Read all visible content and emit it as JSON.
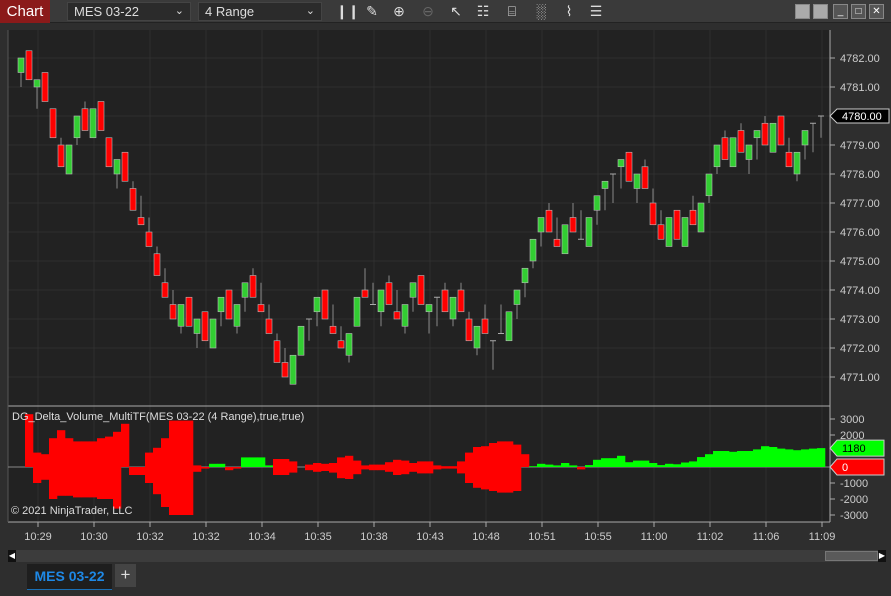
{
  "toolbar": {
    "chart_label": "Chart",
    "instrument": "MES 03-22",
    "bar_type": "4 Range",
    "icons": [
      "bar-type-icon",
      "drawing-tool-icon",
      "zoom-in-icon",
      "zoom-out-icon",
      "pointer-icon",
      "data-box-icon",
      "chart-trader-icon",
      "indicators-icon",
      "strategies-icon",
      "properties-icon"
    ],
    "window_buttons": [
      "minimize",
      "maximize",
      "close"
    ]
  },
  "colors": {
    "up": "#32cd32",
    "down": "#ff0000",
    "background": "#222222",
    "grid": "#2f2f2f",
    "delta_up": "#00ff00",
    "delta_down": "#ff0000"
  },
  "price_axis": {
    "labels": [
      "4782.00",
      "4781.00",
      "4780.00",
      "4779.00",
      "4778.00",
      "4777.00",
      "4776.00",
      "4775.00",
      "4774.00",
      "4773.00",
      "4772.00",
      "4771.00"
    ],
    "current": "4780.00"
  },
  "indicator": {
    "title": "DG_Delta_Volume_MultiTF(MES 03-22 (4 Range),true,true)",
    "labels": [
      "3000",
      "2000",
      "-1000",
      "-2000",
      "-3000"
    ],
    "current_up": "1180",
    "current_down": "0"
  },
  "copyright": "© 2021 NinjaTrader, LLC",
  "time_axis": {
    "labels": [
      "10:29",
      "10:30",
      "10:32",
      "10:32",
      "10:34",
      "10:35",
      "10:38",
      "10:43",
      "10:48",
      "10:51",
      "10:55",
      "11:00",
      "11:02",
      "11:06",
      "11:09"
    ]
  },
  "tabs": [
    {
      "label": "MES 03-22",
      "active": true
    }
  ],
  "chart_data": {
    "type": "candlestick",
    "ohlc_order": "open,high,low,close",
    "candles": [
      [
        4781.5,
        4782,
        4781,
        4782
      ],
      [
        4782.25,
        4782.25,
        4781.25,
        4781.25
      ],
      [
        4781,
        4781.25,
        4780.25,
        4781.25
      ],
      [
        4781.5,
        4781.5,
        4780.5,
        4780.5
      ],
      [
        4780.25,
        4780.25,
        4779.25,
        4779.25
      ],
      [
        4779,
        4779.25,
        4778.25,
        4778.25
      ],
      [
        4778,
        4779,
        4778,
        4779
      ],
      [
        4779.25,
        4780,
        4779,
        4780
      ],
      [
        4780.25,
        4780.5,
        4779.5,
        4779.5
      ],
      [
        4779.25,
        4780.25,
        4779.25,
        4780.25
      ],
      [
        4780.5,
        4780.5,
        4779.5,
        4779.5
      ],
      [
        4779.25,
        4779.25,
        4778.25,
        4778.25
      ],
      [
        4778,
        4778.5,
        4777.5,
        4778.5
      ],
      [
        4778.75,
        4778.75,
        4777.75,
        4777.75
      ],
      [
        4777.5,
        4777.75,
        4776.75,
        4776.75
      ],
      [
        4776.5,
        4777.25,
        4776.25,
        4776.25
      ],
      [
        4776,
        4776.5,
        4775.5,
        4775.5
      ],
      [
        4775.25,
        4775.5,
        4774.5,
        4774.5
      ],
      [
        4774.25,
        4774.75,
        4773.75,
        4773.75
      ],
      [
        4773.5,
        4774,
        4773,
        4773
      ],
      [
        4772.75,
        4773.5,
        4772.5,
        4773.5
      ],
      [
        4773.75,
        4773.75,
        4772.75,
        4772.75
      ],
      [
        4772.5,
        4773,
        4772,
        4773
      ],
      [
        4773.25,
        4773.25,
        4772.25,
        4772.25
      ],
      [
        4772,
        4773,
        4772,
        4773
      ],
      [
        4773.25,
        4773.75,
        4772.75,
        4773.75
      ],
      [
        4774,
        4774,
        4773,
        4773
      ],
      [
        4772.75,
        4773.5,
        4772.5,
        4773.5
      ],
      [
        4773.75,
        4774.25,
        4773.25,
        4774.25
      ],
      [
        4774.5,
        4774.75,
        4773.75,
        4773.75
      ],
      [
        4773.5,
        4774.25,
        4773.25,
        4773.25
      ],
      [
        4773,
        4773.5,
        4772.5,
        4772.5
      ],
      [
        4772.25,
        4772.5,
        4771.5,
        4771.5
      ],
      [
        4771.5,
        4772,
        4771,
        4771
      ],
      [
        4770.75,
        4771.75,
        4770.75,
        4771.75
      ],
      [
        4771.75,
        4772.75,
        4771.75,
        4772.75
      ],
      [
        4773,
        4773,
        4772.25,
        4773
      ],
      [
        4773.25,
        4773.75,
        4772.75,
        4773.75
      ],
      [
        4774,
        4774,
        4773,
        4773
      ],
      [
        4772.75,
        4773.5,
        4772.5,
        4772.5
      ],
      [
        4772.25,
        4772.75,
        4772,
        4772
      ],
      [
        4771.75,
        4772.5,
        4771.5,
        4772.5
      ],
      [
        4772.75,
        4773.75,
        4772.75,
        4773.75
      ],
      [
        4774,
        4774.75,
        4773.75,
        4773.75
      ],
      [
        4773.5,
        4774.25,
        4773.5,
        4773.5
      ],
      [
        4773.25,
        4774,
        4772.75,
        4774
      ],
      [
        4774.25,
        4774.5,
        4773.5,
        4773.5
      ],
      [
        4773.25,
        4774,
        4773,
        4773
      ],
      [
        4772.75,
        4773.5,
        4772.5,
        4773.5
      ],
      [
        4773.75,
        4774.25,
        4773.25,
        4774.25
      ],
      [
        4774.5,
        4774.5,
        4773.5,
        4773.5
      ],
      [
        4773.25,
        4773.5,
        4772.5,
        4773.5
      ],
      [
        4773.75,
        4773.75,
        4772.75,
        4773.75
      ],
      [
        4774,
        4774.25,
        4773.25,
        4773.25
      ],
      [
        4773,
        4773.75,
        4772.75,
        4773.75
      ],
      [
        4774,
        4774.25,
        4773.25,
        4773.25
      ],
      [
        4773,
        4773.25,
        4772.25,
        4772.25
      ],
      [
        4772,
        4772.75,
        4771.75,
        4772.75
      ],
      [
        4773,
        4773.5,
        4772.5,
        4772.5
      ],
      [
        4772.25,
        4772.25,
        4771.25,
        4772.25
      ],
      [
        4772.5,
        4773.5,
        4772.5,
        4772.5
      ],
      [
        4772.25,
        4773.25,
        4772.25,
        4773.25
      ],
      [
        4773.5,
        4774,
        4773,
        4774
      ],
      [
        4774.25,
        4774.75,
        4773.75,
        4774.75
      ],
      [
        4775,
        4775.75,
        4774.75,
        4775.75
      ],
      [
        4776,
        4776.5,
        4775.5,
        4776.5
      ],
      [
        4776.75,
        4777,
        4776,
        4776
      ],
      [
        4775.75,
        4776.5,
        4775.5,
        4775.5
      ],
      [
        4775.25,
        4776.25,
        4775.25,
        4776.25
      ],
      [
        4776.5,
        4777,
        4776,
        4776
      ],
      [
        4775.75,
        4776.75,
        4775.75,
        4775.75
      ],
      [
        4775.5,
        4776.5,
        4775.5,
        4776.5
      ],
      [
        4776.75,
        4777.25,
        4776.25,
        4777.25
      ],
      [
        4777.5,
        4777.75,
        4776.75,
        4777.75
      ],
      [
        4778,
        4778,
        4777,
        4778
      ],
      [
        4778.25,
        4778.5,
        4777.5,
        4778.5
      ],
      [
        4778.75,
        4778.75,
        4777.75,
        4777.75
      ],
      [
        4777.5,
        4778,
        4777,
        4778
      ],
      [
        4778.25,
        4778.5,
        4777.5,
        4777.5
      ],
      [
        4777,
        4777.5,
        4776.25,
        4776.25
      ],
      [
        4776.25,
        4776.75,
        4775.75,
        4775.75
      ],
      [
        4775.5,
        4776.5,
        4775.5,
        4776.5
      ],
      [
        4776.75,
        4776.75,
        4775.75,
        4775.75
      ],
      [
        4775.5,
        4776.5,
        4775.5,
        4776.5
      ],
      [
        4776.75,
        4777.25,
        4776.25,
        4776.25
      ],
      [
        4776,
        4777,
        4776,
        4777
      ],
      [
        4777.25,
        4778,
        4777,
        4778
      ],
      [
        4778.25,
        4779,
        4778,
        4779
      ],
      [
        4779.25,
        4779.5,
        4778.5,
        4778.5
      ],
      [
        4778.25,
        4779.25,
        4778.25,
        4779.25
      ],
      [
        4779.5,
        4779.75,
        4778.75,
        4778.75
      ],
      [
        4778.5,
        4779,
        4778,
        4779
      ],
      [
        4779.25,
        4779.5,
        4778.5,
        4779.5
      ],
      [
        4779.75,
        4780,
        4779,
        4779
      ],
      [
        4778.75,
        4779.75,
        4778.75,
        4779.75
      ],
      [
        4780,
        4780,
        4779,
        4779
      ],
      [
        4778.75,
        4779.25,
        4778.25,
        4778.25
      ],
      [
        4778,
        4778.75,
        4777.75,
        4778.75
      ],
      [
        4779,
        4779.5,
        4778.5,
        4779.5
      ],
      [
        4779.75,
        4779.75,
        4778.75,
        4779.75
      ],
      [
        4780,
        4780,
        4779.25,
        4780
      ]
    ],
    "price_range": [
      4770.5,
      4783
    ],
    "delta_range": [
      -3000,
      3300
    ],
    "delta_bars": [
      [
        0,
        0,
        "r"
      ],
      [
        3300,
        0,
        "r"
      ],
      [
        900,
        1000,
        "r"
      ],
      [
        800,
        800,
        "r"
      ],
      [
        1800,
        2000,
        "r"
      ],
      [
        2300,
        1800,
        "r"
      ],
      [
        1800,
        1800,
        "r"
      ],
      [
        1600,
        1900,
        "r"
      ],
      [
        1600,
        1900,
        "r"
      ],
      [
        1600,
        1900,
        "r"
      ],
      [
        1800,
        2000,
        "r"
      ],
      [
        1900,
        2000,
        "r"
      ],
      [
        2200,
        2600,
        "r"
      ],
      [
        2700,
        0,
        "r"
      ],
      [
        0,
        500,
        "r"
      ],
      [
        0,
        500,
        "r"
      ],
      [
        900,
        1000,
        "r"
      ],
      [
        1200,
        1700,
        "r"
      ],
      [
        1800,
        2500,
        "r"
      ],
      [
        2900,
        3000,
        "r"
      ],
      [
        2900,
        3000,
        "r"
      ],
      [
        2900,
        3000,
        "r"
      ],
      [
        100,
        300,
        "r"
      ],
      [
        0,
        100,
        "r"
      ],
      [
        200,
        0,
        "g"
      ],
      [
        200,
        0,
        "g"
      ],
      [
        0,
        200,
        "r"
      ],
      [
        0,
        100,
        "r"
      ],
      [
        600,
        0,
        "g"
      ],
      [
        600,
        0,
        "g"
      ],
      [
        600,
        0,
        "g"
      ],
      [
        100,
        0,
        "g"
      ],
      [
        500,
        500,
        "r"
      ],
      [
        500,
        500,
        "r"
      ],
      [
        350,
        350,
        "r"
      ],
      [
        0,
        0,
        "r"
      ],
      [
        150,
        200,
        "r"
      ],
      [
        250,
        300,
        "r"
      ],
      [
        200,
        250,
        "r"
      ],
      [
        250,
        350,
        "r"
      ],
      [
        600,
        700,
        "r"
      ],
      [
        700,
        750,
        "r"
      ],
      [
        400,
        450,
        "r"
      ],
      [
        100,
        150,
        "r"
      ],
      [
        150,
        200,
        "r"
      ],
      [
        150,
        200,
        "r"
      ],
      [
        300,
        300,
        "r"
      ],
      [
        450,
        500,
        "r"
      ],
      [
        400,
        450,
        "r"
      ],
      [
        250,
        300,
        "r"
      ],
      [
        350,
        400,
        "r"
      ],
      [
        350,
        400,
        "r"
      ],
      [
        100,
        150,
        "r"
      ],
      [
        50,
        100,
        "r"
      ],
      [
        50,
        100,
        "r"
      ],
      [
        350,
        400,
        "r"
      ],
      [
        900,
        1000,
        "r"
      ],
      [
        1250,
        1300,
        "r"
      ],
      [
        1300,
        1400,
        "r"
      ],
      [
        1500,
        1500,
        "r"
      ],
      [
        1600,
        1600,
        "r"
      ],
      [
        1600,
        1600,
        "r"
      ],
      [
        1400,
        1500,
        "r"
      ],
      [
        800,
        0,
        "r"
      ],
      [
        50,
        0,
        "g"
      ],
      [
        200,
        0,
        "g"
      ],
      [
        150,
        0,
        "g"
      ],
      [
        100,
        0,
        "g"
      ],
      [
        250,
        0,
        "g"
      ],
      [
        100,
        0,
        "g"
      ],
      [
        0,
        150,
        "r"
      ],
      [
        120,
        0,
        "g"
      ],
      [
        450,
        0,
        "g"
      ],
      [
        550,
        0,
        "g"
      ],
      [
        550,
        0,
        "g"
      ],
      [
        700,
        0,
        "g"
      ],
      [
        300,
        0,
        "g"
      ],
      [
        400,
        0,
        "g"
      ],
      [
        400,
        0,
        "g"
      ],
      [
        250,
        0,
        "g"
      ],
      [
        120,
        0,
        "g"
      ],
      [
        200,
        0,
        "g"
      ],
      [
        170,
        0,
        "g"
      ],
      [
        280,
        0,
        "g"
      ],
      [
        350,
        0,
        "g"
      ],
      [
        620,
        0,
        "g"
      ],
      [
        800,
        0,
        "g"
      ],
      [
        1000,
        0,
        "g"
      ],
      [
        1000,
        0,
        "g"
      ],
      [
        950,
        0,
        "g"
      ],
      [
        1000,
        0,
        "g"
      ],
      [
        1000,
        0,
        "g"
      ],
      [
        1100,
        0,
        "g"
      ],
      [
        1300,
        0,
        "g"
      ],
      [
        1250,
        0,
        "g"
      ],
      [
        1150,
        0,
        "g"
      ],
      [
        1100,
        0,
        "g"
      ],
      [
        1050,
        0,
        "g"
      ],
      [
        1100,
        0,
        "g"
      ],
      [
        1150,
        0,
        "g"
      ],
      [
        1180,
        0,
        "g"
      ]
    ]
  }
}
